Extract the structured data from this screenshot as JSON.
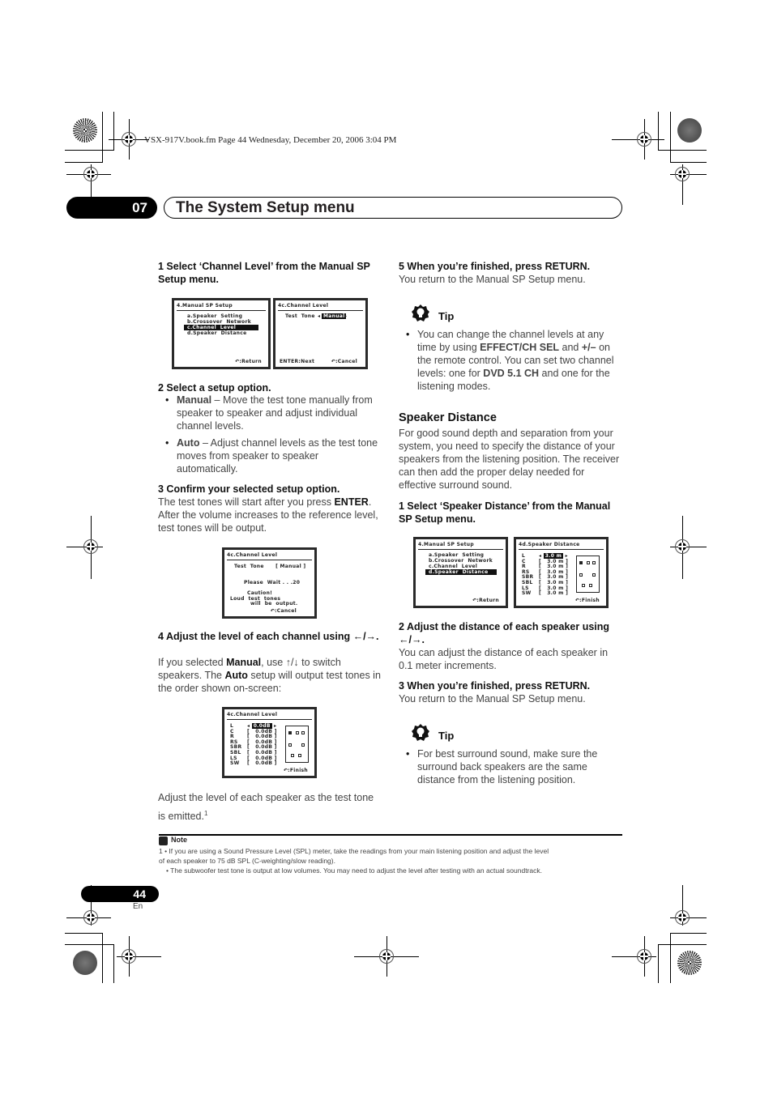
{
  "print_header": "VSX-917V.book.fm  Page 44  Wednesday, December 20, 2006  3:04 PM",
  "chapter": {
    "number": "07",
    "title": "The System Setup menu"
  },
  "left": {
    "step1": "1    Select ‘Channel Level’ from the Manual SP Setup menu.",
    "step2": "2    Select a setup option.",
    "manual_label": "Manual",
    "manual_text": " – Move the test tone manually from speaker to speaker and adjust individual channel levels.",
    "auto_label": "Auto",
    "auto_text": " – Adjust channel levels as the test tone moves from speaker to speaker automatically.",
    "step3": "3    Confirm your selected setup option.",
    "step3_text_a": "The test tones will start after you press ",
    "step3_enter": "ENTER",
    "step3_text_b": ". After the volume increases to the reference level, test tones will be output.",
    "step4": "4    Adjust the level of each channel using ←/→.",
    "step4_a": "If you selected ",
    "step4_manual": "Manual",
    "step4_b": ", use ↑/↓ to switch speakers. The ",
    "step4_auto": "Auto",
    "step4_c": " setup will output test tones in the order shown on-screen:",
    "caption": "Adjust the level of each speaker as the test tone is emitted.",
    "caption_ref": "1"
  },
  "right": {
    "step5": "5    When you’re finished, press RETURN.",
    "step5_text": "You return to the Manual SP Setup menu.",
    "tip_label": "Tip",
    "tip1_a": "You can change the channel levels at any time by using ",
    "tip1_b": "EFFECT/CH SEL",
    "tip1_c": " and ",
    "tip1_d": "+/–",
    "tip1_e": " on the remote control. You can set two channel levels: one for ",
    "tip1_f": "DVD 5.1 CH",
    "tip1_g": " and one for the listening modes.",
    "section_title": "Speaker Distance",
    "section_text": "For good sound depth and separation from your system, you need to specify the distance of your speakers from the listening position. The receiver can then add the proper delay needed for effective surround sound.",
    "sd_step1": "1    Select ‘Speaker Distance’ from the Manual SP Setup menu.",
    "sd_step2": "2    Adjust the distance of each speaker using ←/→.",
    "sd_step2_text": "You can adjust the distance of each speaker in 0.1 meter increments.",
    "sd_step3": "3    When you’re finished, press RETURN.",
    "sd_step3_text": "You return to the Manual SP Setup menu.",
    "tip2": "For best surround sound, make sure the surround back speakers are the same distance from the listening position."
  },
  "osd": {
    "manual_sp": {
      "title": "4.Manual  SP  Setup",
      "items": [
        "a.Speaker  Setting",
        "b.Crossover  Network",
        "c.Channel  Level",
        "d.Speaker  Distance"
      ],
      "footer": "↶:Return"
    },
    "channel_level_start": {
      "title": "4c.Channel  Level",
      "row": "Test  Tone",
      "value": "Manual",
      "footer_left": "ENTER:Next",
      "footer_right": "↶:Cancel"
    },
    "channel_level_wait": {
      "title": "4c.Channel  Level",
      "row": "Test  Tone      [ Manual ]",
      "wait": "Please  Wait . . .20",
      "caution1": "Caution!",
      "caution2": "Loud  test  tones",
      "caution3": "will  be  output.",
      "footer": "↶:Cancel"
    },
    "channel_level_adjust": {
      "title": "4c.Channel  Level",
      "channels": [
        "L",
        "C",
        "R",
        "RS",
        "SBR",
        "SBL",
        "LS",
        "SW"
      ],
      "values": [
        "0.0dB",
        "0.0dB",
        "0.0dB",
        "0.0dB",
        "0.0dB",
        "0.0dB",
        "0.0dB",
        "0.0dB"
      ],
      "footer": "↶:Finish"
    },
    "speaker_distance": {
      "title": "4d.Speaker  Distance",
      "channels": [
        "L",
        "C",
        "R",
        "RS",
        "SBR",
        "SBL",
        "LS",
        "SW"
      ],
      "values": [
        "3.0 m",
        "3.0 m",
        "3.0 m",
        "3.0 m",
        "3.0 m",
        "3.0 m",
        "3.0 m",
        "3.0 m"
      ],
      "footer": "↶:Finish"
    }
  },
  "note": {
    "label": "Note",
    "line1": "1  • If you are using a Sound Pressure Level (SPL) meter, take the readings from your main listening position and adjust the level",
    "line2": "of each speaker to 75 dB SPL (C-weighting/slow reading).",
    "line3": "• The subwoofer test tone is output at low volumes. You may need to adjust the level after testing with an actual soundtrack."
  },
  "footer": {
    "page": "44",
    "lang": "En"
  }
}
